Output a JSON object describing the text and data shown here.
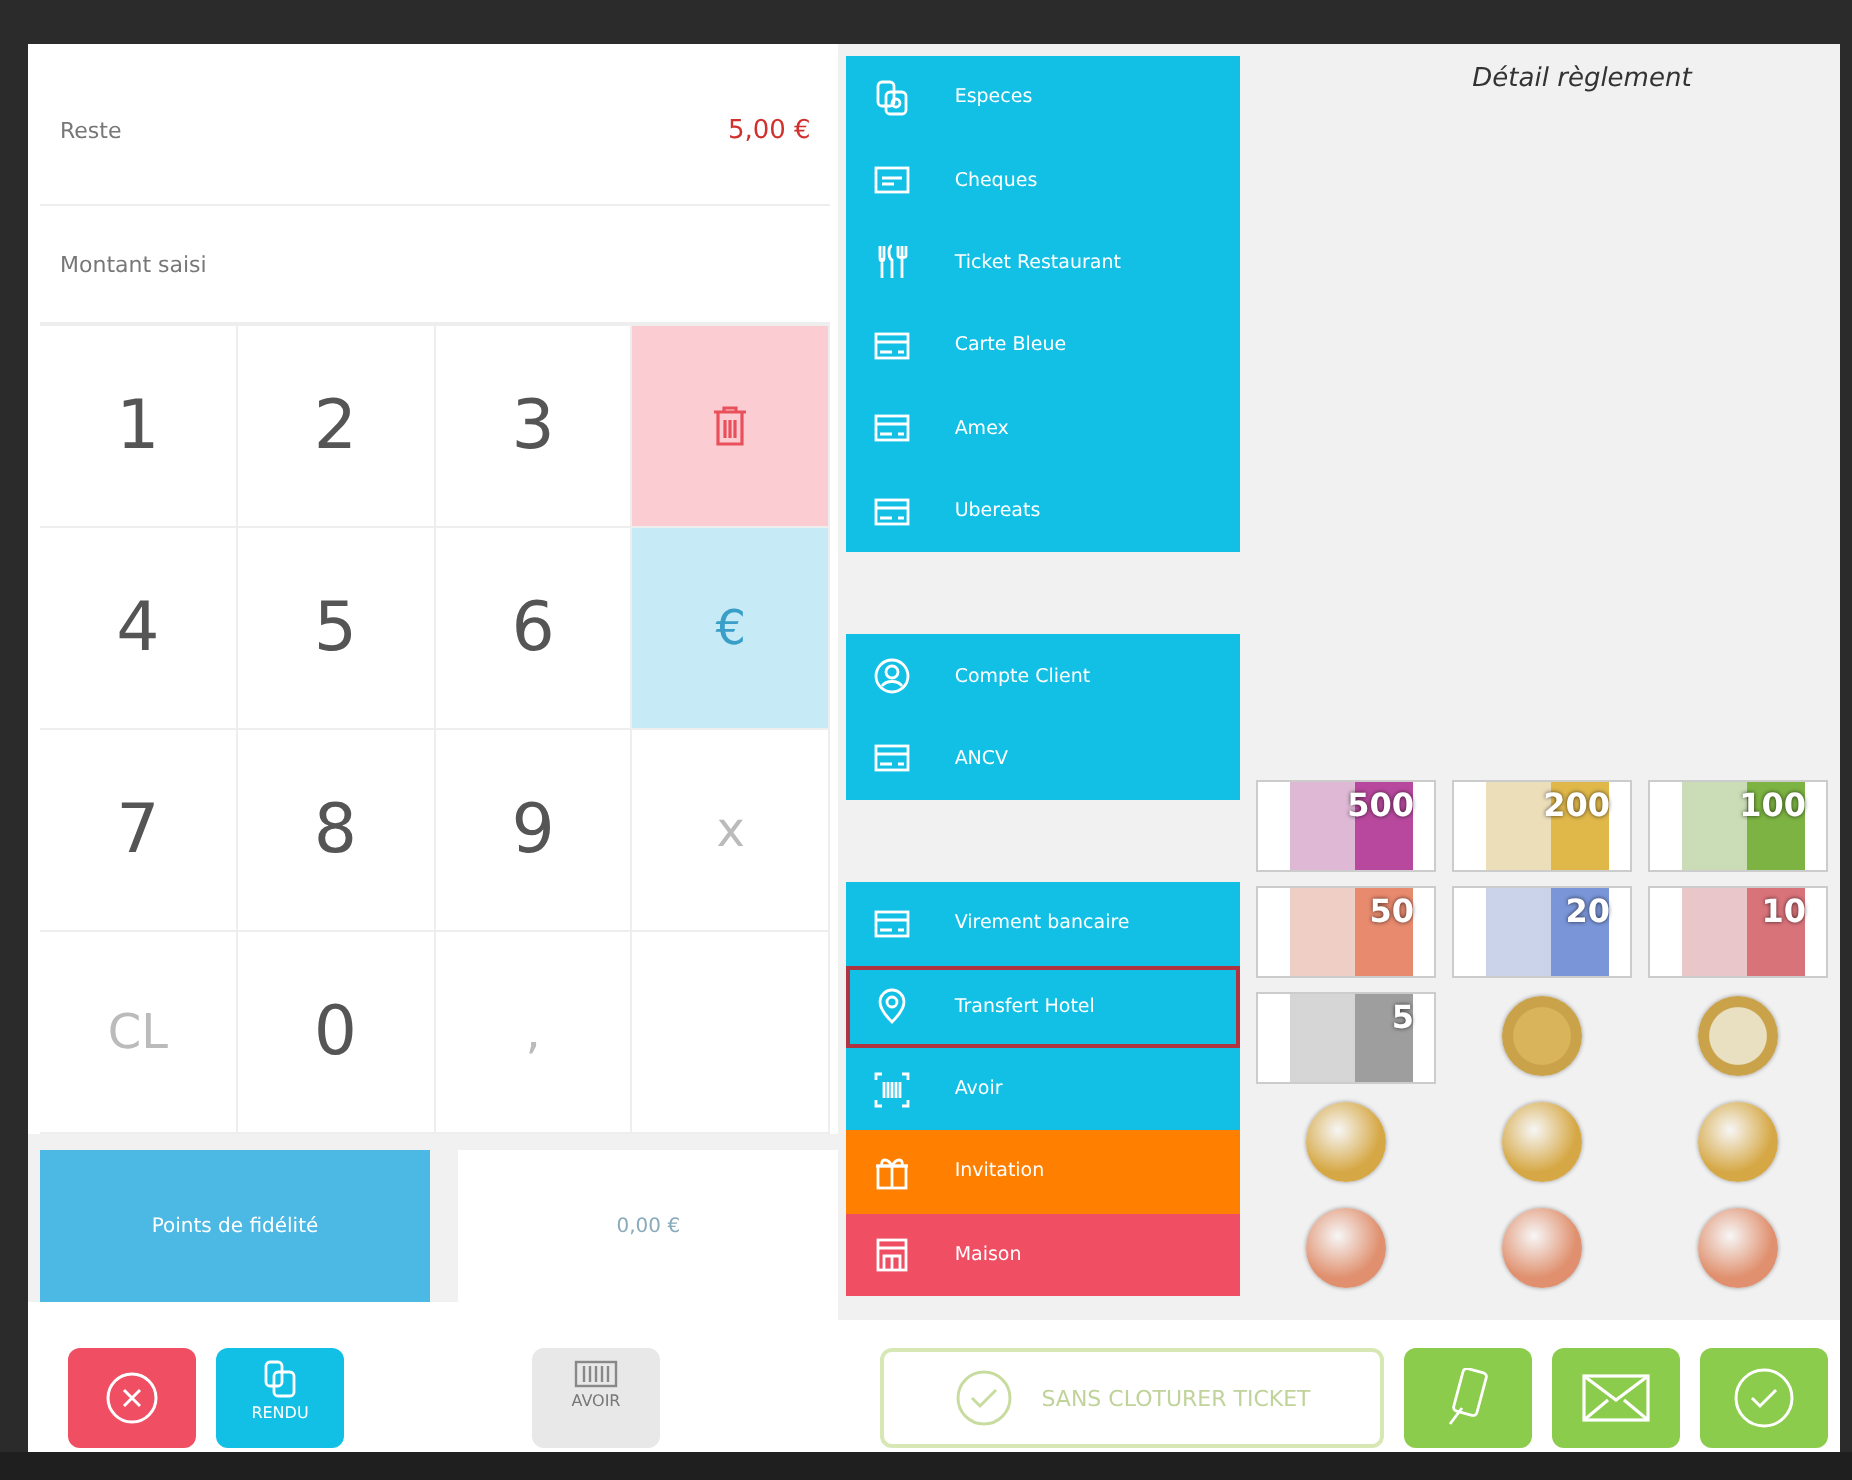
{
  "summary": {
    "remaining_label": "Reste",
    "remaining_value": "5,00 €",
    "entered_label": "Montant saisi"
  },
  "keypad": [
    {
      "kind": "digit",
      "label": "1"
    },
    {
      "kind": "digit",
      "label": "2"
    },
    {
      "kind": "digit",
      "label": "3"
    },
    {
      "kind": "delete"
    },
    {
      "kind": "digit",
      "label": "4"
    },
    {
      "kind": "digit",
      "label": "5"
    },
    {
      "kind": "digit",
      "label": "6"
    },
    {
      "kind": "currency",
      "label": "€"
    },
    {
      "kind": "digit",
      "label": "7"
    },
    {
      "kind": "digit",
      "label": "8"
    },
    {
      "kind": "digit",
      "label": "9"
    },
    {
      "kind": "muted",
      "label": "x"
    },
    {
      "kind": "muted",
      "label": "CL"
    },
    {
      "kind": "digit",
      "label": "0"
    },
    {
      "kind": "muted",
      "label": ","
    },
    {
      "kind": "blank"
    }
  ],
  "loyalty": {
    "label": "Points de fidélité",
    "value": "0,00 €"
  },
  "payment_methods": [
    {
      "label": "Especes",
      "kind": "cash",
      "color": "#12c0e6",
      "selected": false,
      "gap_before": false
    },
    {
      "label": "Cheques",
      "kind": "cheque",
      "color": "#12c0e6",
      "selected": false,
      "gap_before": false
    },
    {
      "label": "Ticket Restaurant",
      "kind": "cutlery",
      "color": "#12c0e6",
      "selected": false,
      "gap_before": false
    },
    {
      "label": "Carte Bleue",
      "kind": "card",
      "color": "#12c0e6",
      "selected": false,
      "gap_before": false
    },
    {
      "label": "Amex",
      "kind": "card",
      "color": "#12c0e6",
      "selected": false,
      "gap_before": false
    },
    {
      "label": "Ubereats",
      "kind": "card",
      "color": "#12c0e6",
      "selected": false,
      "gap_before": false
    },
    {
      "label": "Compte Client",
      "kind": "user",
      "color": "#12c0e6",
      "selected": false,
      "gap_before": true
    },
    {
      "label": "ANCV",
      "kind": "card",
      "color": "#12c0e6",
      "selected": false,
      "gap_before": false
    },
    {
      "label": "Virement bancaire",
      "kind": "card",
      "color": "#12c0e6",
      "selected": false,
      "gap_before": true
    },
    {
      "label": "Transfert Hotel",
      "kind": "pin",
      "color": "#12c0e6",
      "selected": true,
      "gap_before": false
    },
    {
      "label": "Avoir",
      "kind": "barcode",
      "color": "#12c0e6",
      "selected": false,
      "gap_before": false
    },
    {
      "label": "Invitation",
      "kind": "gift",
      "color": "#ff8000",
      "selected": false,
      "gap_before": false
    },
    {
      "label": "Maison",
      "kind": "house",
      "color": "#ef4e63",
      "selected": false,
      "gap_before": false
    }
  ],
  "detail": {
    "title": "Détail règlement"
  },
  "money": [
    {
      "kind": "note",
      "value": "500",
      "color": "#b8489e"
    },
    {
      "kind": "note",
      "value": "200",
      "color": "#e0b84a"
    },
    {
      "kind": "note",
      "value": "100",
      "color": "#7cb342"
    },
    {
      "kind": "note",
      "value": "50",
      "color": "#e88a6e"
    },
    {
      "kind": "note",
      "value": "20",
      "color": "#7a95d8"
    },
    {
      "kind": "note",
      "value": "10",
      "color": "#d9737a"
    },
    {
      "kind": "note",
      "value": "5",
      "color": "#9e9e9e"
    },
    {
      "kind": "bicolor_coin",
      "color": "#d9b45a"
    },
    {
      "kind": "bicolor_coin",
      "color": "#e8e0c0"
    },
    {
      "kind": "coin",
      "color": "#d6a845"
    },
    {
      "kind": "coin",
      "color": "#d6a845"
    },
    {
      "kind": "coin",
      "color": "#d6a845"
    },
    {
      "kind": "coin",
      "color": "#e0906e"
    },
    {
      "kind": "coin",
      "color": "#e0906e"
    },
    {
      "kind": "coin",
      "color": "#e0906e"
    }
  ],
  "actions": [
    {
      "kind": "cancel"
    },
    {
      "kind": "change",
      "label": "RENDU"
    },
    {
      "kind": "credit",
      "label": "AVOIR"
    },
    {
      "kind": "keep_open",
      "label": "SANS CLOTURER TICKET"
    },
    {
      "kind": "phone"
    },
    {
      "kind": "mail"
    },
    {
      "kind": "validate"
    }
  ]
}
